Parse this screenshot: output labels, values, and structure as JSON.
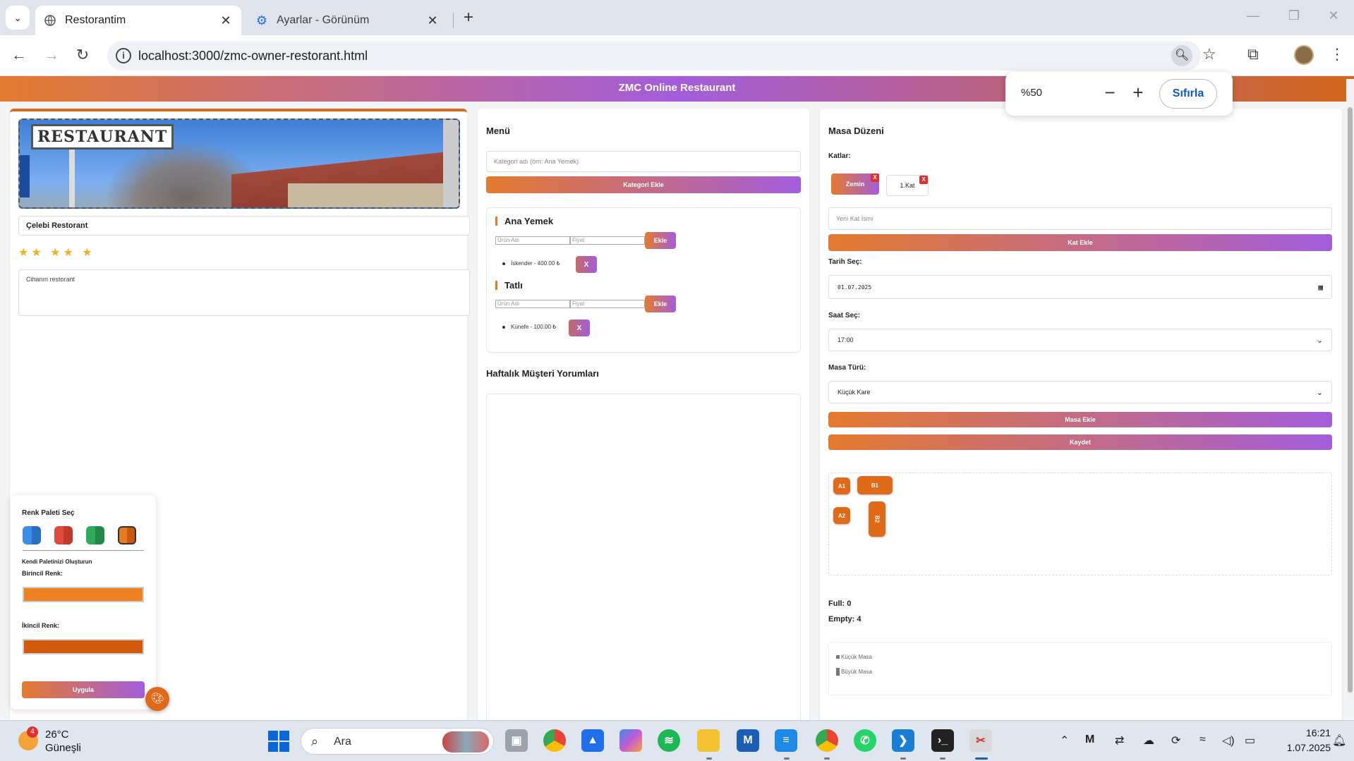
{
  "browser": {
    "tabs": [
      {
        "label": "Restorantim",
        "active": true,
        "icon": "globe-icon"
      },
      {
        "label": "Ayarlar - Görünüm",
        "active": false,
        "icon": "gear-icon"
      }
    ],
    "url": "localhost:3000/zmc-owner-restorant.html"
  },
  "zoom_popup": {
    "value": "%50",
    "minus": "−",
    "plus": "+",
    "reset_label": "Sıfırla"
  },
  "site": {
    "header_title": "ZMC Online Restaurant"
  },
  "restaurant": {
    "photo_sign": "RESTAURANT",
    "name": "Çelebi Restorant",
    "stars": "★★ ★★ ★",
    "description": "Cihanın restorant"
  },
  "menu": {
    "title": "Menü",
    "category_placeholder": "Kategori adı (örn: Ana Yemek)",
    "add_category_label": "Kategori Ekle",
    "categories": [
      {
        "name": "Ana Yemek",
        "product_placeholder": "Ürün Adı",
        "price_placeholder": "Fiyat",
        "add_label": "Ekle",
        "items": [
          {
            "text": "İskender - 400.00 ₺",
            "remove": "X"
          }
        ]
      },
      {
        "name": "Tatlı",
        "product_placeholder": "Ürün Adı",
        "price_placeholder": "Fiyat",
        "add_label": "Ekle",
        "items": [
          {
            "text": "Künefe - 100.00 ₺",
            "remove": "X"
          }
        ]
      }
    ],
    "reviews_title": "Haftalık Müşteri Yorumları"
  },
  "tables": {
    "title": "Masa Düzeni",
    "floors_label": "Katlar:",
    "floors": [
      {
        "name": "Zemin",
        "active": true,
        "remove": "X"
      },
      {
        "name": "1.Kat",
        "active": false,
        "remove": "X"
      }
    ],
    "new_floor_placeholder": "Yeni Kat İsmi",
    "add_floor_label": "Kat Ekle",
    "date_label": "Tarih Seç:",
    "date_value": "01.07.2025",
    "time_label": "Saat Seç:",
    "time_value": "17:00",
    "type_label": "Masa Türü:",
    "type_value": "Küçük Kare",
    "add_table_label": "Masa Ekle",
    "save_label": "Kaydet",
    "layout": [
      {
        "label": "A1",
        "kind": "small"
      },
      {
        "label": "B1",
        "kind": "large"
      },
      {
        "label": "A2",
        "kind": "small"
      },
      {
        "label": "B2",
        "kind": "large-vertical"
      }
    ],
    "full_text": "Full: 0",
    "empty_text": "Empty: 4",
    "legend": [
      {
        "label": "Küçük Masa"
      },
      {
        "label": "Büyük Masa"
      }
    ]
  },
  "palette": {
    "title": "Renk Paleti Seç",
    "swatches": [
      {
        "name": "blue",
        "a": "#3a8ee6",
        "b": "#2a6fc0"
      },
      {
        "name": "red",
        "a": "#e04a3a",
        "b": "#c0392b"
      },
      {
        "name": "green",
        "a": "#2eaa5a",
        "b": "#1f8a45"
      },
      {
        "name": "orange",
        "a": "#e87a22",
        "b": "#c75a10"
      }
    ],
    "custom_title": "Kendi Paletinizi Oluşturun",
    "primary_label": "Birincil Renk:",
    "primary_color": "#ee8222",
    "secondary_label": "İkincil Renk:",
    "secondary_color": "#d05a0a",
    "apply_label": "Uygula"
  },
  "taskbar": {
    "weather_temp": "26°C",
    "weather_cond": "Güneşli",
    "weather_badge": "4",
    "search_label": "Ara",
    "time": "16:21",
    "date": "1.07.2025"
  },
  "colors": {
    "accent_orange": "#e47a2e",
    "accent_purple": "#a35ddc",
    "table_orange": "#e06a18"
  }
}
